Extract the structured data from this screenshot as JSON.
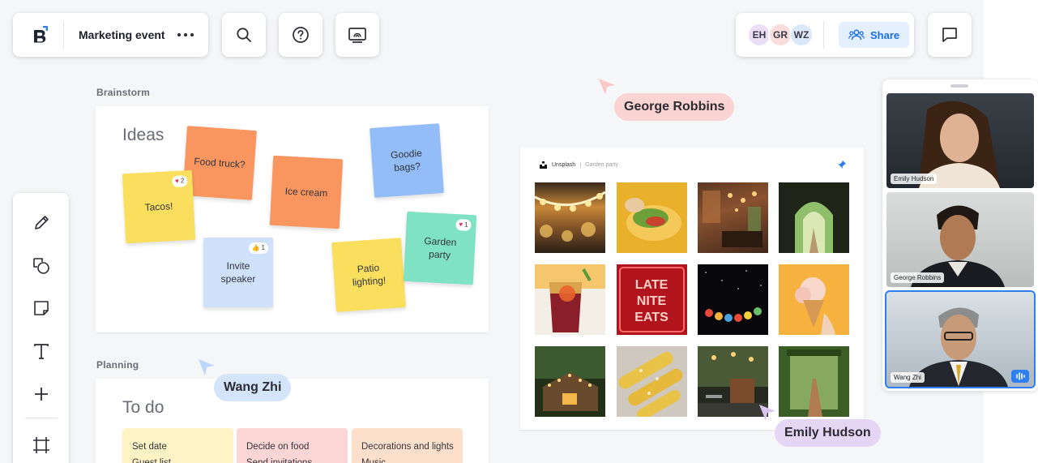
{
  "app": {
    "board_title": "Marketing event"
  },
  "collaborators": {
    "avatars": [
      {
        "initials": "EH",
        "color": "#ecdff5"
      },
      {
        "initials": "GR",
        "color": "#f9dcdc"
      },
      {
        "initials": "WZ",
        "color": "#dbe8fb"
      }
    ],
    "share_label": "Share"
  },
  "brainstorm": {
    "section_label": "Brainstorm",
    "title": "Ideas",
    "stickies": [
      {
        "text": "Food truck?",
        "color": "#f9965f"
      },
      {
        "text": "Tacos!",
        "color": "#fadf5e",
        "reaction_count": "2",
        "reaction": "heart"
      },
      {
        "text": "Ice cream",
        "color": "#f9965f"
      },
      {
        "text": "Goodie bags?",
        "color": "#92bdf8"
      },
      {
        "text": "Invite speaker",
        "color": "#cfe1fb",
        "reaction_count": "1",
        "reaction": "thumbs-up"
      },
      {
        "text": "Patio lighting!",
        "color": "#fadf5e"
      },
      {
        "text": "Garden party",
        "color": "#7fe2c2",
        "reaction_count": "1",
        "reaction": "heart"
      }
    ]
  },
  "planning": {
    "section_label": "Planning",
    "title": "To do",
    "columns": [
      {
        "items": [
          "Set date",
          "Guest list"
        ],
        "color": "#fdf3c4"
      },
      {
        "items": [
          "Decide on food",
          "Send invitations"
        ],
        "color": "#fcd5d5"
      },
      {
        "items": [
          "Decorations and lights",
          "Music"
        ],
        "color": "#fde0cc"
      }
    ]
  },
  "cursors": [
    {
      "name": "George Robbins",
      "color": "#fbd3d3"
    },
    {
      "name": "Wang Zhi",
      "color": "#d4e4fb"
    },
    {
      "name": "Emily Hudson",
      "color": "#e6d6f6"
    }
  ],
  "gallery": {
    "source": "Unsplash",
    "query": "Garden party",
    "images": [
      "string-lights",
      "taco",
      "restaurant-interior",
      "garden-archway",
      "sangria-drink",
      "late-nite-eats-neon",
      "paper-lanterns",
      "ice-cream-cone",
      "cabin-lights",
      "grilled-corn",
      "patio-cafe",
      "garden-path"
    ]
  },
  "neon_sign": {
    "lines": [
      "LATE",
      "NITE",
      "EATS"
    ]
  },
  "video_call": {
    "participants": [
      {
        "name": "Emily Hudson",
        "speaking": false
      },
      {
        "name": "George Robbins",
        "speaking": false
      },
      {
        "name": "Wang Zhi",
        "speaking": true
      }
    ]
  },
  "toolbar": {
    "tools": [
      "pen-icon",
      "shapes-icon",
      "sticky-note-icon",
      "text-icon",
      "plus-icon",
      "frame-icon"
    ]
  },
  "colors": {
    "accent": "#1a6ee6",
    "canvas": "#f5f6f8"
  }
}
